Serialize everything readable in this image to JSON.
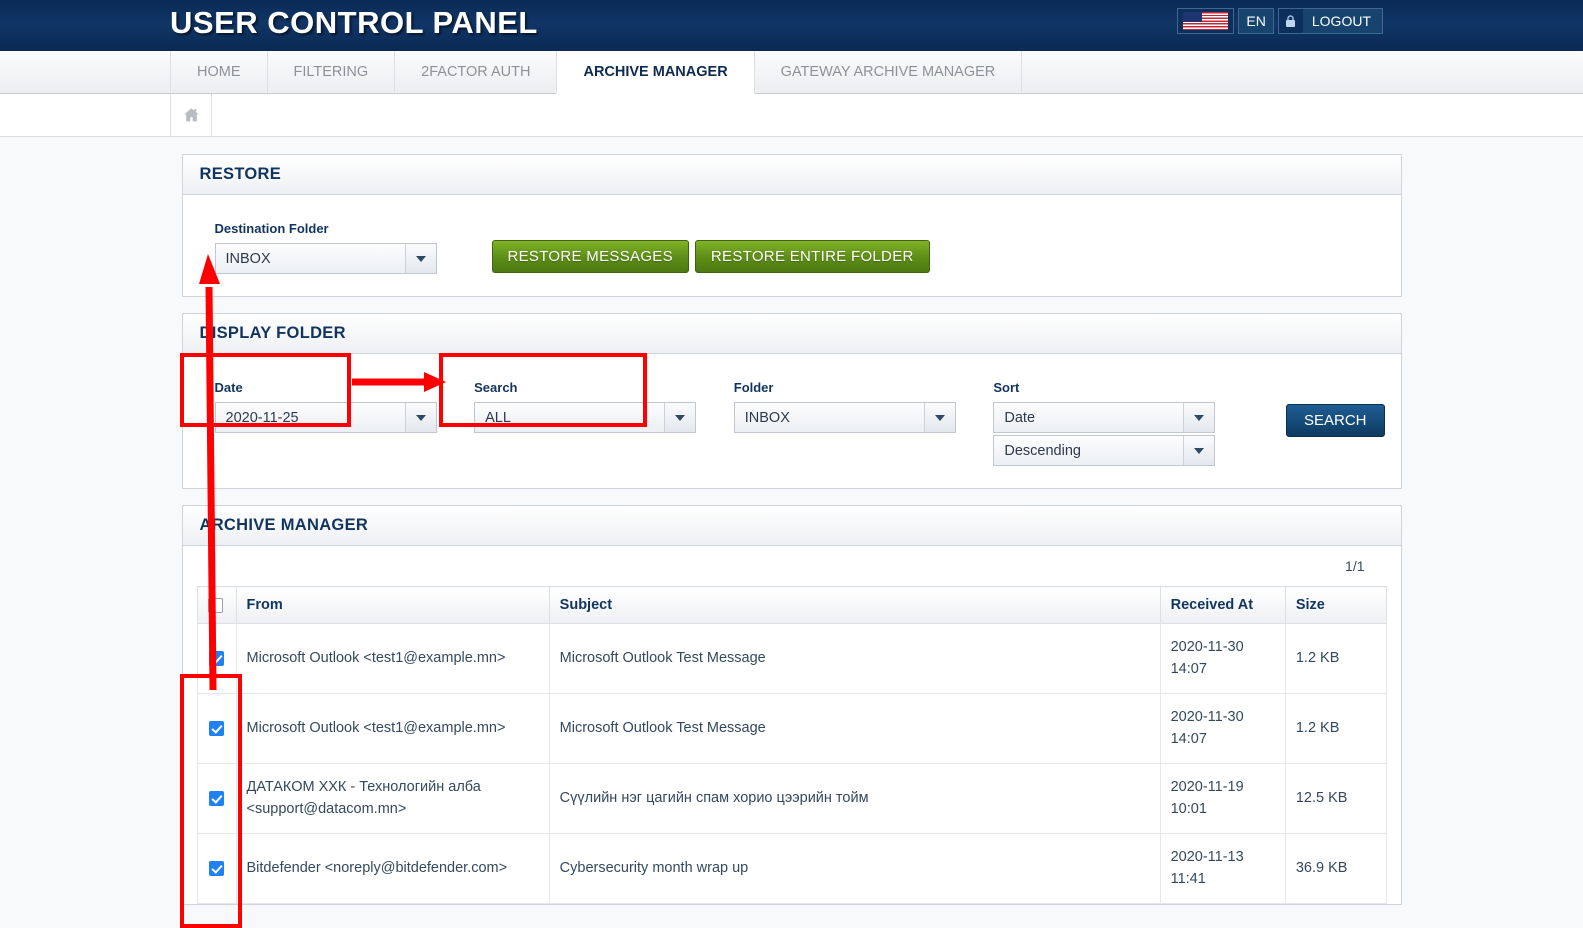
{
  "header": {
    "title": "USER CONTROL PANEL",
    "flag_icon": "us-flag-icon",
    "language": "EN",
    "logout": "LOGOUT",
    "lock_icon": "lock-icon"
  },
  "nav": {
    "tabs": [
      {
        "label": "HOME",
        "active": false
      },
      {
        "label": "FILTERING",
        "active": false
      },
      {
        "label": "2FACTOR AUTH",
        "active": false
      },
      {
        "label": "ARCHIVE MANAGER",
        "active": true
      },
      {
        "label": "GATEWAY ARCHIVE MANAGER",
        "active": false
      }
    ]
  },
  "breadcrumb": {
    "home_icon": "home-icon"
  },
  "restore_panel": {
    "title": "RESTORE",
    "destination_label": "Destination Folder",
    "destination_value": "INBOX",
    "restore_messages_label": "RESTORE MESSAGES",
    "restore_entire_label": "RESTORE ENTIRE FOLDER"
  },
  "display_folder_panel": {
    "title": "DISPLAY FOLDER",
    "date_label": "Date",
    "date_value": "2020-11-25",
    "search_label": "Search",
    "search_value": "ALL",
    "folder_label": "Folder",
    "folder_value": "INBOX",
    "sort_label": "Sort",
    "sort_field_value": "Date",
    "sort_dir_value": "Descending",
    "search_button_label": "SEARCH"
  },
  "archive_panel": {
    "title": "ARCHIVE MANAGER",
    "pagination": "1/1",
    "columns": [
      "",
      "From",
      "Subject",
      "Received At",
      "Size"
    ],
    "rows": [
      {
        "checked": true,
        "from": "Microsoft Outlook <test1@example.mn>",
        "subject": "Microsoft Outlook Test Message",
        "received_date": "2020-11-30",
        "received_time": "14:07",
        "size": "1.2 KB"
      },
      {
        "checked": true,
        "from": "Microsoft Outlook <test1@example.mn>",
        "subject": "Microsoft Outlook Test Message",
        "received_date": "2020-11-30",
        "received_time": "14:07",
        "size": "1.2 KB"
      },
      {
        "checked": true,
        "from": "ДАТАКОМ ХХК - Технологийн алба <support@datacom.mn>",
        "subject": "Сүүлийн нэг цагийн спам хорио цээрийн тойм",
        "received_date": "2020-11-19",
        "received_time": "10:01",
        "size": "12.5 KB"
      },
      {
        "checked": true,
        "from": "Bitdefender <noreply@bitdefender.com>",
        "subject": "Cybersecurity month wrap up",
        "received_date": "2020-11-13",
        "received_time": "11:41",
        "size": "36.9 KB"
      }
    ]
  },
  "annotations": {
    "color": "#fe0000",
    "highlight_destination_folder": true,
    "highlight_restore_messages": true,
    "arrow_destination_to_restore": true,
    "arrow_checkboxes_to_destination": true,
    "highlight_checkbox_column": true
  },
  "colors": {
    "header_blue": "#0d2f5c",
    "accent_blue": "#12355f",
    "button_green": "#5d8c17",
    "checkbox_blue": "#1f82f0",
    "annotation_red": "#fe0000"
  }
}
